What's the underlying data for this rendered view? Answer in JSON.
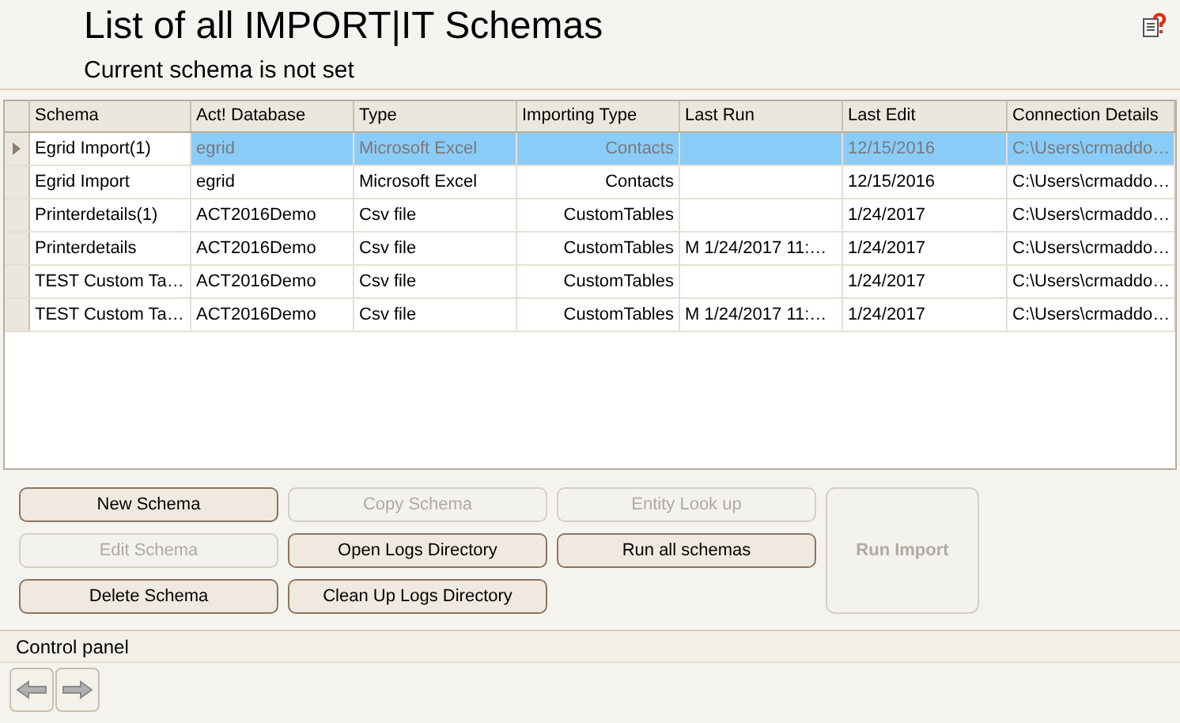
{
  "header": {
    "title": "List of all IMPORT|IT Schemas",
    "subtitle": "Current schema is not set"
  },
  "table": {
    "columns": [
      "Schema",
      "Act! Database",
      "Type",
      "Importing Type",
      "Last Run",
      "Last Edit",
      "Connection Details"
    ],
    "rows": [
      {
        "selected": true,
        "cells": [
          "Egrid Import(1)",
          "egrid",
          "Microsoft Excel",
          "Contacts",
          "",
          "12/15/2016",
          "C:\\Users\\crmaddo…"
        ]
      },
      {
        "selected": false,
        "cells": [
          "Egrid Import",
          "egrid",
          "Microsoft Excel",
          "Contacts",
          "",
          "12/15/2016",
          "C:\\Users\\crmaddo…"
        ]
      },
      {
        "selected": false,
        "cells": [
          "Printerdetails(1)",
          "ACT2016Demo",
          "Csv file",
          "CustomTables",
          "",
          "1/24/2017",
          "C:\\Users\\crmaddo…"
        ]
      },
      {
        "selected": false,
        "cells": [
          "Printerdetails",
          "ACT2016Demo",
          "Csv file",
          "CustomTables",
          "M 1/24/2017 11:…",
          "1/24/2017",
          "C:\\Users\\crmaddo…"
        ]
      },
      {
        "selected": false,
        "cells": [
          "TEST Custom Ta…",
          "ACT2016Demo",
          "Csv file",
          "CustomTables",
          "",
          "1/24/2017",
          "C:\\Users\\crmaddo…"
        ]
      },
      {
        "selected": false,
        "cells": [
          "TEST Custom Ta…",
          "ACT2016Demo",
          "Csv file",
          "CustomTables",
          "M 1/24/2017 11:…",
          "1/24/2017",
          "C:\\Users\\crmaddo…"
        ]
      }
    ]
  },
  "buttons": [
    {
      "label": "New Schema",
      "disabled": false,
      "kind": "normal"
    },
    {
      "label": "Edit Schema",
      "disabled": true,
      "kind": "normal"
    },
    {
      "label": "Delete Schema",
      "disabled": false,
      "kind": "normal"
    },
    {
      "label": "Copy Schema",
      "disabled": true,
      "kind": "normal"
    },
    {
      "label": "Open Logs Directory",
      "disabled": false,
      "kind": "normal"
    },
    {
      "label": "Clean Up Logs Directory",
      "disabled": false,
      "kind": "normal"
    },
    {
      "label": "Entity Look up",
      "disabled": true,
      "kind": "normal"
    },
    {
      "label": "Run all schemas",
      "disabled": false,
      "kind": "normal"
    },
    {
      "label": "Run Import",
      "disabled": true,
      "kind": "large"
    }
  ],
  "control_panel": {
    "title": "Control panel"
  }
}
